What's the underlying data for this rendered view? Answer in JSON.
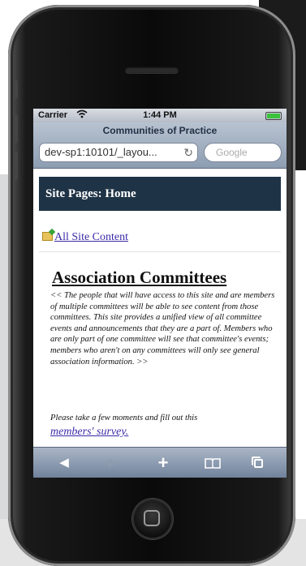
{
  "status_bar": {
    "carrier": "Carrier",
    "time": "1:44 PM"
  },
  "browser": {
    "page_title": "Communities of Practice",
    "url": "dev-sp1:10101/_layou...",
    "search_placeholder": "Google"
  },
  "page": {
    "site_pages_label": "Site Pages: Home",
    "all_site_content_label": "All Site Content",
    "heading": "Association Committees",
    "description": "<< The people that will have access to this site and are members of multiple committees will be able to see content from those committees.  This site provides a unified view of all committee events and announcements that they are a part of.  Members who are only part of one committee will see that committee's events; members who aren't on any committees will only see general association information. >>",
    "survey_prompt": "Please take a few moments and fill out this",
    "survey_link": "members' survey."
  },
  "toolbar": {
    "icons": [
      "back-icon",
      "forward-icon",
      "add-icon",
      "bookmarks-icon",
      "pages-icon"
    ]
  },
  "colors": {
    "site_pages_bar": "#1f3346",
    "link": "#3a2aa8",
    "battery": "#3cc23c"
  }
}
